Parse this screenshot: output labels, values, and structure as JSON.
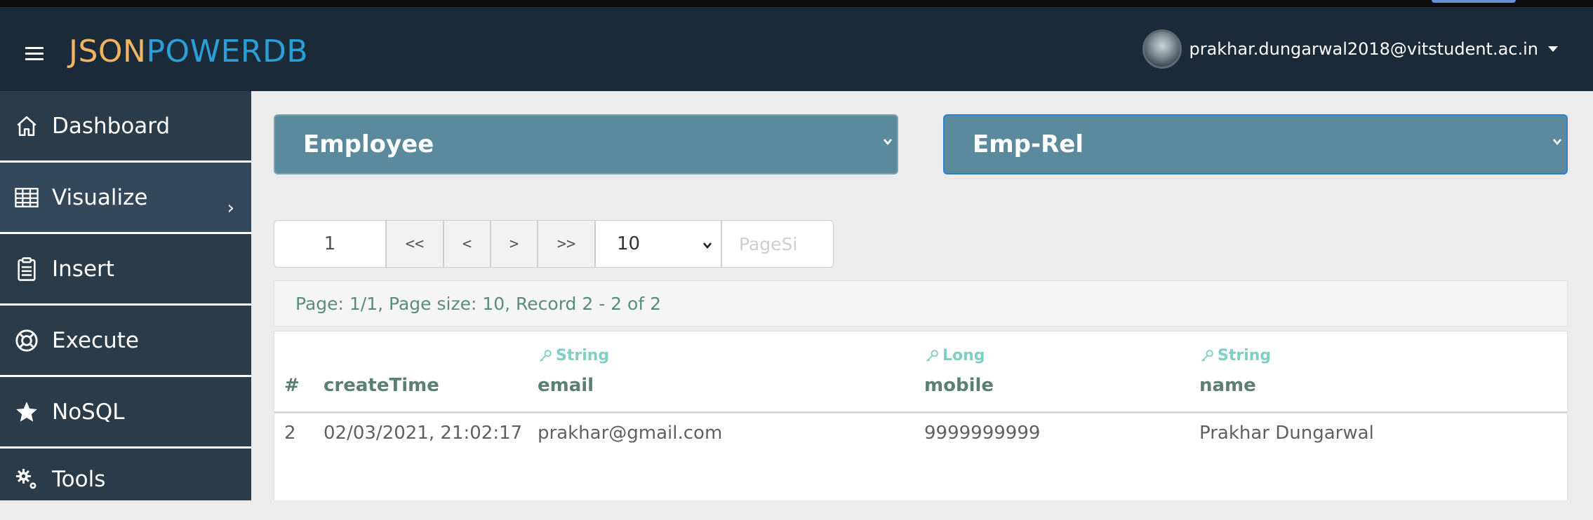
{
  "header": {
    "logo_part1": "JSON",
    "logo_part2": "POWERDB",
    "user_email": "prakhar.dungarwal2018@vitstudent.ac.in"
  },
  "sidebar": {
    "items": [
      {
        "label": "Dashboard",
        "icon": "home-icon"
      },
      {
        "label": "Visualize",
        "icon": "table-icon"
      },
      {
        "label": "Insert",
        "icon": "clipboard-icon"
      },
      {
        "label": "Execute",
        "icon": "lifebuoy-icon"
      },
      {
        "label": "NoSQL",
        "icon": "star-icon"
      },
      {
        "label": "Tools",
        "icon": "gears-icon"
      }
    ]
  },
  "selectors": {
    "database": "Employee",
    "relation": "Emp-Rel"
  },
  "pager": {
    "page_number": "1",
    "first": "<<",
    "prev": "<",
    "next": ">",
    "last": ">>",
    "page_size": "10",
    "page_size_placeholder": "PageSi"
  },
  "info": "Page: 1/1, Page size: 10, Record 2 - 2 of 2",
  "table": {
    "columns": [
      {
        "name": "#",
        "type": ""
      },
      {
        "name": "createTime",
        "type": ""
      },
      {
        "name": "email",
        "type": "String"
      },
      {
        "name": "mobile",
        "type": "Long"
      },
      {
        "name": "name",
        "type": "String"
      }
    ],
    "rows": [
      [
        "2",
        "02/03/2021, 21:02:17",
        "prakhar@gmail.com",
        "9999999999",
        "Prakhar Dungarwal"
      ]
    ]
  },
  "colors": {
    "header_bg": "#1b2a39",
    "sidebar_bg": "#2a3b49",
    "select_bg": "#5a8a9c",
    "logo_json": "#f1b463",
    "logo_powerdb": "#2a9fd6",
    "type_label": "#7fcfc3"
  }
}
